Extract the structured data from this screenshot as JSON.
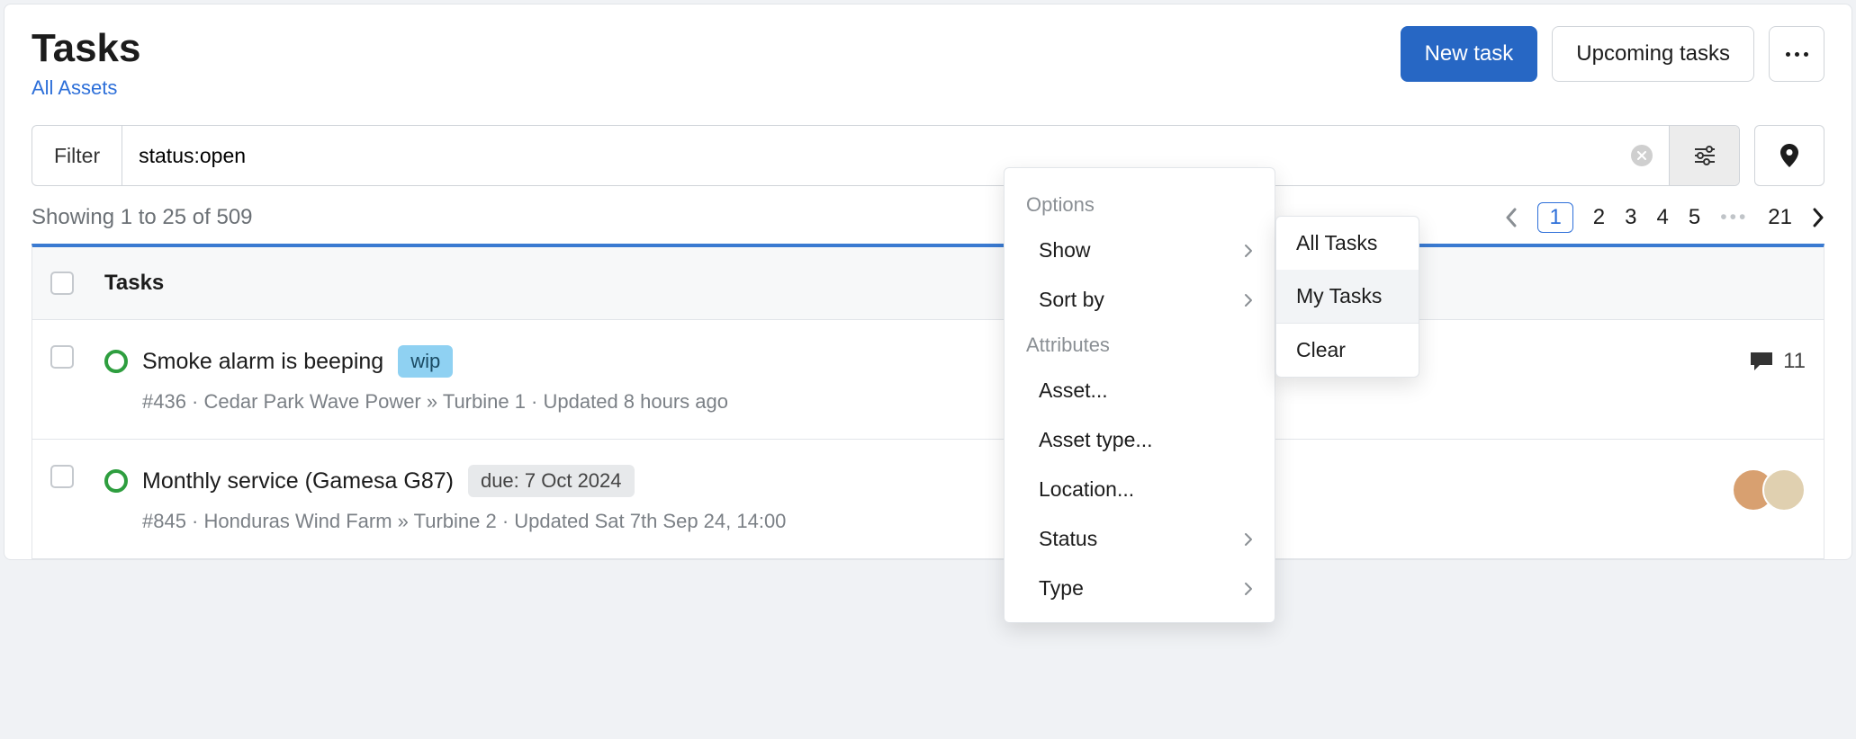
{
  "header": {
    "title": "Tasks",
    "breadcrumb": "All Assets",
    "new_task": "New task",
    "upcoming": "Upcoming tasks"
  },
  "filter": {
    "label": "Filter",
    "value": "status:open"
  },
  "showing": "Showing 1 to 25 of 509",
  "pagination": {
    "pages": [
      "1",
      "2",
      "3",
      "4",
      "5"
    ],
    "last": "21"
  },
  "columns": {
    "tasks": "Tasks"
  },
  "tasks": [
    {
      "title": "Smoke alarm is beeping",
      "tag_type": "wip",
      "tag_text": "wip",
      "meta": "#436  ·  Cedar Park Wave Power » Turbine 1  ·  Updated 8 hours ago",
      "comments": "11"
    },
    {
      "title": "Monthly service (Gamesa G87)",
      "tag_type": "due",
      "tag_text": "due: 7 Oct 2024",
      "meta": "#845  ·  Honduras Wind Farm » Turbine 2  ·  Updated Sat 7th Sep 24, 14:00",
      "avatars": 2
    }
  ],
  "options_menu": {
    "section_options": "Options",
    "show": "Show",
    "sort_by": "Sort by",
    "section_attributes": "Attributes",
    "asset": "Asset...",
    "asset_type": "Asset type...",
    "location": "Location...",
    "status": "Status",
    "type": "Type"
  },
  "show_submenu": {
    "all": "All Tasks",
    "my": "My Tasks",
    "clear": "Clear"
  }
}
